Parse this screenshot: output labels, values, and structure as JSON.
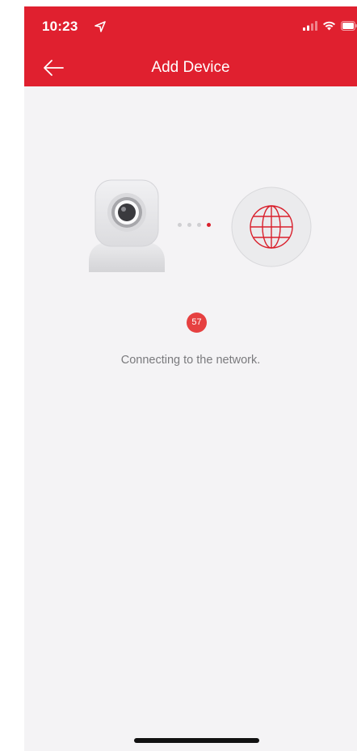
{
  "status_bar": {
    "time": "10:23",
    "icons": [
      "location-arrow-icon",
      "cellular-signal-icon",
      "wifi-icon",
      "battery-icon"
    ]
  },
  "header": {
    "title": "Add Device",
    "back_icon": "back-arrow-icon",
    "color": "#e0202f"
  },
  "illustration": {
    "left_icon": "camera-icon",
    "right_icon": "globe-icon",
    "progress_dots_total": 4,
    "progress_dots_active": 4
  },
  "countdown": {
    "value": "57",
    "color": "#e64040"
  },
  "message": "Connecting to the network."
}
